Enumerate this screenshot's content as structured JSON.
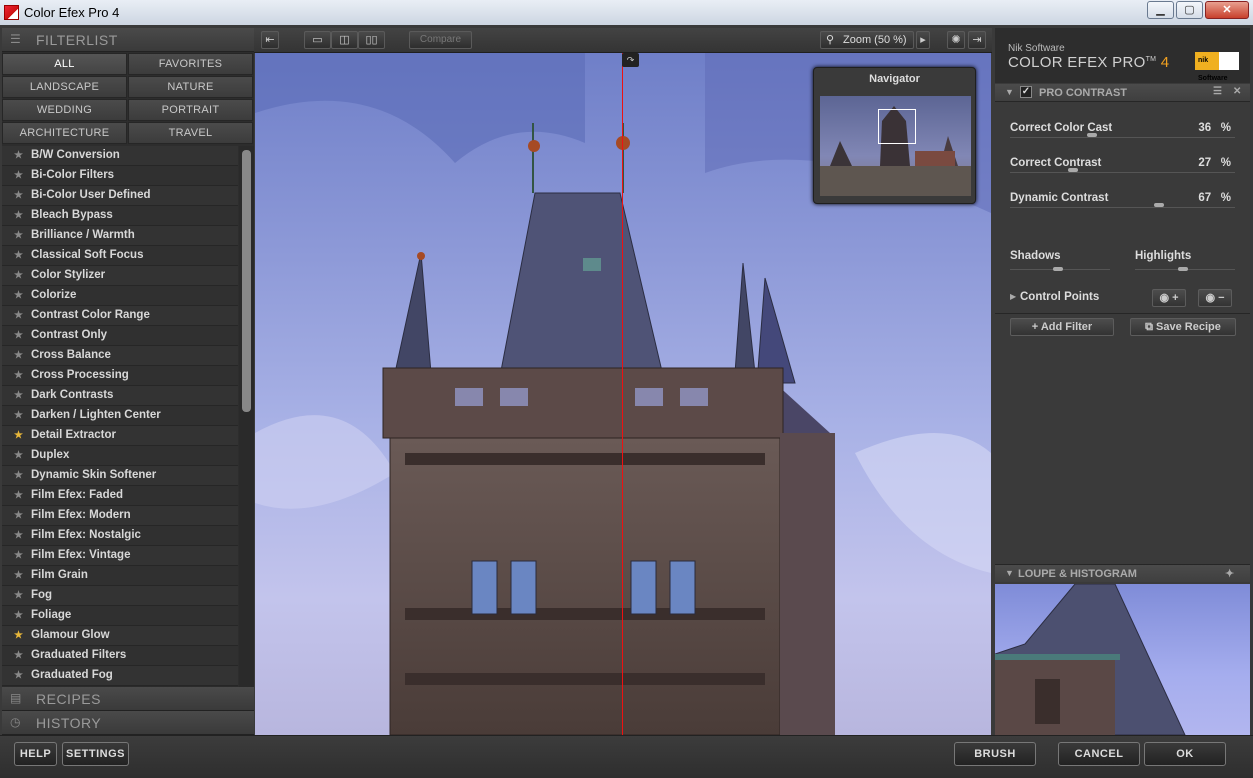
{
  "window": {
    "title": "Color Efex Pro 4",
    "min_glyph": "▁",
    "max_glyph": "▢",
    "close_glyph": "✕"
  },
  "filterlist": {
    "header": "FILTERLIST",
    "categories": [
      "ALL",
      "FAVORITES",
      "LANDSCAPE",
      "NATURE",
      "WEDDING",
      "PORTRAIT",
      "ARCHITECTURE",
      "TRAVEL"
    ],
    "selected_category": "ALL",
    "items": [
      {
        "name": "B/W Conversion",
        "fav": false
      },
      {
        "name": "Bi-Color Filters",
        "fav": false
      },
      {
        "name": "Bi-Color User Defined",
        "fav": false
      },
      {
        "name": "Bleach Bypass",
        "fav": false
      },
      {
        "name": "Brilliance / Warmth",
        "fav": false
      },
      {
        "name": "Classical Soft Focus",
        "fav": false
      },
      {
        "name": "Color Stylizer",
        "fav": false
      },
      {
        "name": "Colorize",
        "fav": false
      },
      {
        "name": "Contrast Color Range",
        "fav": false
      },
      {
        "name": "Contrast Only",
        "fav": false
      },
      {
        "name": "Cross Balance",
        "fav": false
      },
      {
        "name": "Cross Processing",
        "fav": false
      },
      {
        "name": "Dark Contrasts",
        "fav": false
      },
      {
        "name": "Darken / Lighten Center",
        "fav": false
      },
      {
        "name": "Detail Extractor",
        "fav": true
      },
      {
        "name": "Duplex",
        "fav": false
      },
      {
        "name": "Dynamic Skin Softener",
        "fav": false
      },
      {
        "name": "Film Efex: Faded",
        "fav": false
      },
      {
        "name": "Film Efex: Modern",
        "fav": false
      },
      {
        "name": "Film Efex: Nostalgic",
        "fav": false
      },
      {
        "name": "Film Efex: Vintage",
        "fav": false
      },
      {
        "name": "Film Grain",
        "fav": false
      },
      {
        "name": "Fog",
        "fav": false
      },
      {
        "name": "Foliage",
        "fav": false
      },
      {
        "name": "Glamour Glow",
        "fav": true
      },
      {
        "name": "Graduated Filters",
        "fav": false
      },
      {
        "name": "Graduated Fog",
        "fav": false
      }
    ],
    "star_glyph": "★"
  },
  "recipes": {
    "header": "RECIPES"
  },
  "history": {
    "header": "HISTORY"
  },
  "toolbar": {
    "compare_label": "Compare",
    "zoom_label": "Zoom (50 %)",
    "zoom_arrow": "▸"
  },
  "navigator": {
    "title": "Navigator"
  },
  "brand": {
    "company": "Nik Software",
    "product": "COLOR EFEX PRO",
    "tm": "TM",
    "version": "4",
    "logo_text": "nik Software"
  },
  "filter_panel": {
    "title": "PRO CONTRAST",
    "controls": [
      {
        "label": "Correct Color Cast",
        "value": "36",
        "unit": "%",
        "level": 0.36
      },
      {
        "label": "Correct Contrast",
        "value": "27",
        "unit": "%",
        "level": 0.27
      },
      {
        "label": "Dynamic Contrast",
        "value": "67",
        "unit": "%",
        "level": 0.67
      }
    ],
    "shadows_label": "Shadows",
    "shadows_level": 0.5,
    "highlights_label": "Highlights",
    "highlights_level": 0.5,
    "control_points_label": "Control Points",
    "add_filter_label": "Add Filter",
    "save_recipe_label": "Save Recipe"
  },
  "loupe": {
    "header": "LOUPE & HISTOGRAM"
  },
  "bottom": {
    "help": "HELP",
    "settings": "SETTINGS",
    "brush": "BRUSH",
    "cancel": "CANCEL",
    "ok": "OK"
  },
  "colors": {
    "accent": "#f0a020",
    "split_line": "#e11111",
    "favorite_star": "#e8b73a"
  }
}
